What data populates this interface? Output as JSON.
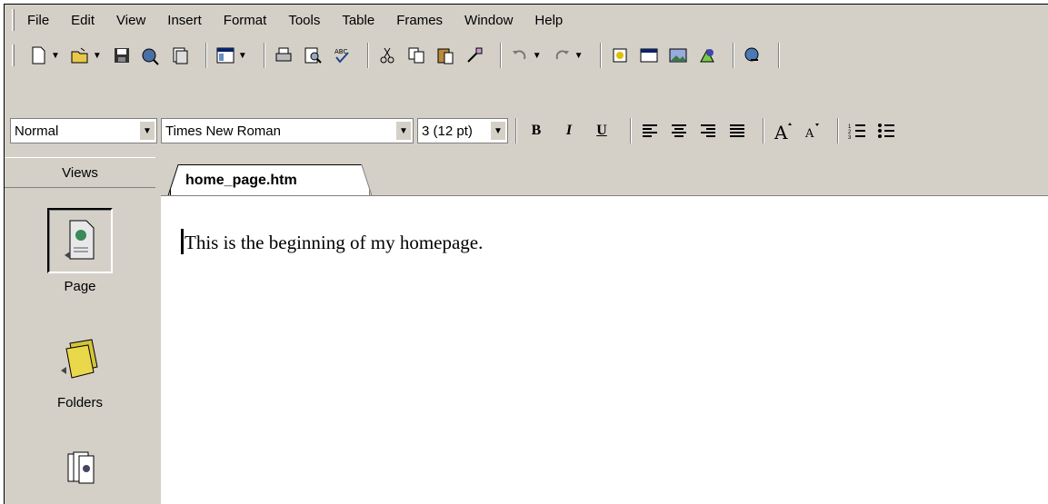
{
  "menu": {
    "items": [
      "File",
      "Edit",
      "View",
      "Insert",
      "Format",
      "Tools",
      "Table",
      "Frames",
      "Window",
      "Help"
    ]
  },
  "format": {
    "style": "Normal",
    "font": "Times New Roman",
    "size": "3  (12 pt)"
  },
  "views": {
    "header": "Views",
    "items": [
      "Page",
      "Folders"
    ]
  },
  "editor": {
    "tab": "home_page.htm",
    "content": "This is the beginning of my homepage."
  }
}
